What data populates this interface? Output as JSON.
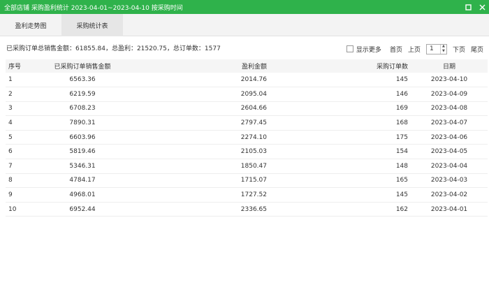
{
  "window": {
    "title": "全部店铺 采购盈利统计 2023-04-01~2023-04-10 按采购时间",
    "maximize_label": "maximize-icon",
    "close_label": "close-icon"
  },
  "tabs": [
    {
      "label": "盈利走势图",
      "active": false
    },
    {
      "label": "采购统计表",
      "active": true
    }
  ],
  "summary": {
    "text": "已采购订单总销售金额：61855.84，总盈利：21520.75，总订单数：1577"
  },
  "pager": {
    "show_more_label": "显示更多",
    "show_more_checked": false,
    "first_label": "首页",
    "prev_label": "上页",
    "current_page": "1",
    "next_label": "下页",
    "last_label": "尾页"
  },
  "table": {
    "headers": [
      "序号",
      "已采购订单销售金额",
      "盈利金额",
      "采购订单数",
      "日期"
    ],
    "rows": [
      [
        "1",
        "6563.36",
        "2014.76",
        "145",
        "2023-04-10"
      ],
      [
        "2",
        "6219.59",
        "2095.04",
        "146",
        "2023-04-09"
      ],
      [
        "3",
        "6708.23",
        "2604.66",
        "169",
        "2023-04-08"
      ],
      [
        "4",
        "7890.31",
        "2797.45",
        "168",
        "2023-04-07"
      ],
      [
        "5",
        "6603.96",
        "2274.10",
        "175",
        "2023-04-06"
      ],
      [
        "6",
        "5819.46",
        "2105.03",
        "154",
        "2023-04-05"
      ],
      [
        "7",
        "5346.31",
        "1850.47",
        "148",
        "2023-04-04"
      ],
      [
        "8",
        "4784.17",
        "1715.07",
        "165",
        "2023-04-03"
      ],
      [
        "9",
        "4968.01",
        "1727.52",
        "145",
        "2023-04-02"
      ],
      [
        "10",
        "6952.44",
        "2336.65",
        "162",
        "2023-04-01"
      ]
    ]
  },
  "colors": {
    "titlebar": "#2fb24b",
    "tab_active": "#e6e6e6",
    "tab_bar": "#f3f3f3"
  }
}
